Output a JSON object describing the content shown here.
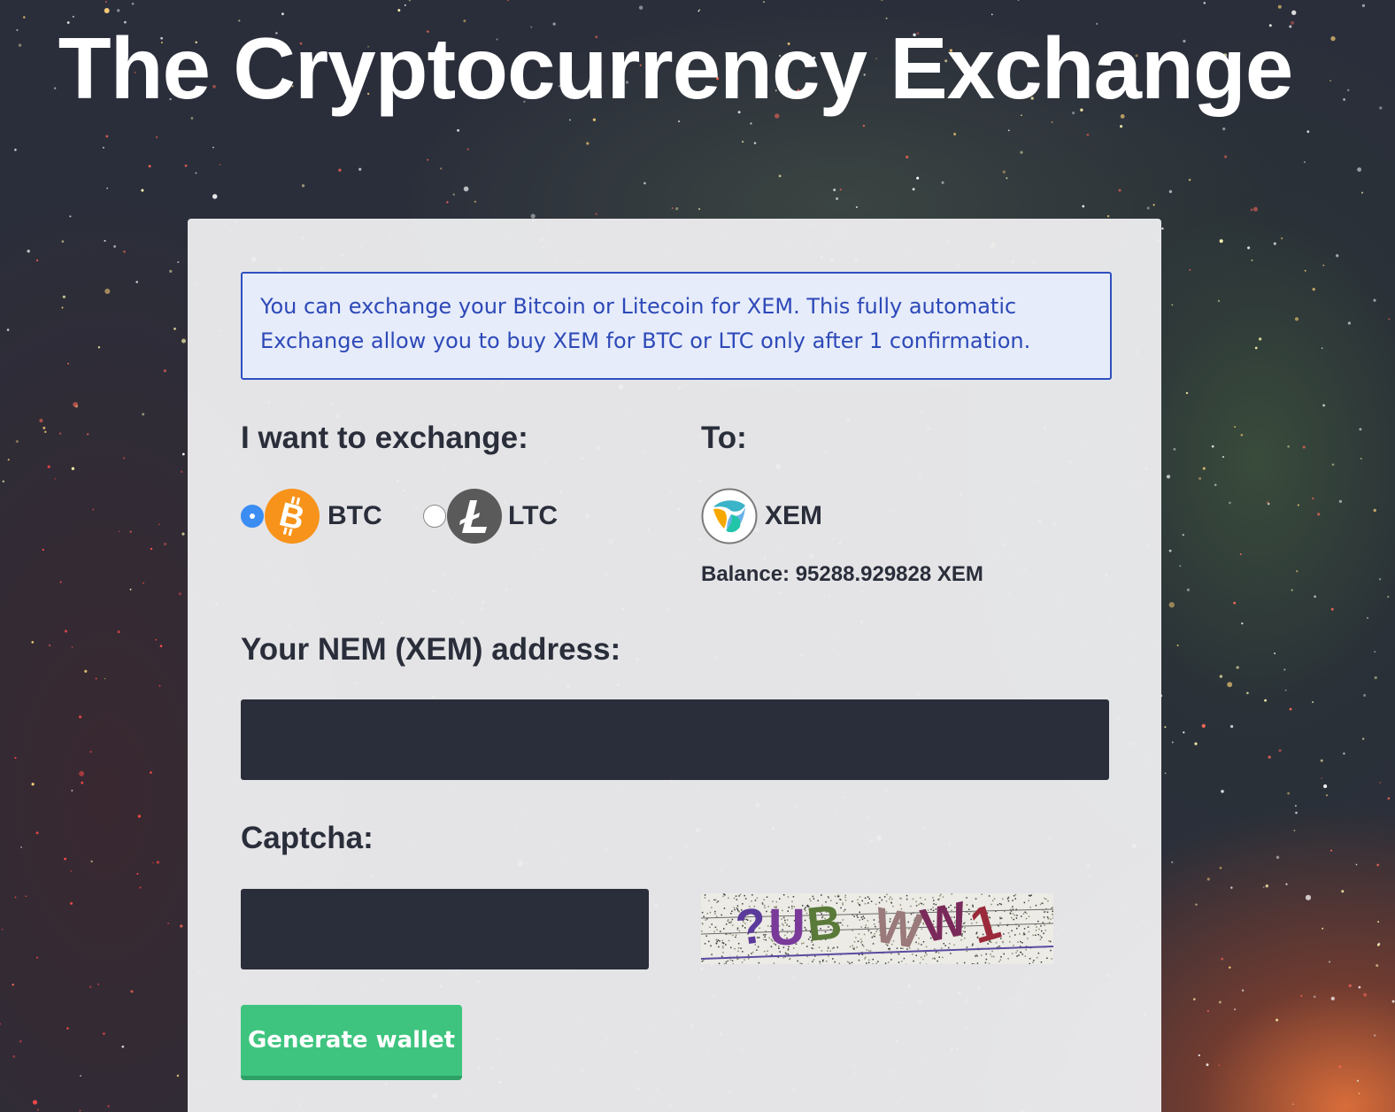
{
  "header": {
    "title": "The Cryptocurrency Exchange"
  },
  "info": {
    "message": "You can exchange your Bitcoin or Litecoin for XEM. This fully automatic Exchange allow you to buy XEM for BTC or LTC only after 1 confirmation."
  },
  "exchange": {
    "from_label": "I want to exchange:",
    "to_label": "To:",
    "options": [
      {
        "code": "BTC",
        "icon": "bitcoin-icon",
        "selected": true,
        "color": "#f7931a"
      },
      {
        "code": "LTC",
        "icon": "litecoin-icon",
        "selected": false,
        "color": "#5a5a5a"
      }
    ],
    "target": {
      "code": "XEM",
      "icon": "nem-icon"
    },
    "balance": "Balance: 95288.929828 XEM"
  },
  "form": {
    "address_label": "Your NEM (XEM) address:",
    "address_value": "",
    "captcha_label": "Captcha:",
    "captcha_value": "",
    "captcha_image_text": "?UB WW1",
    "submit_label": "Generate wallet"
  },
  "colors": {
    "accent_green": "#3ec47f",
    "info_blue": "#2d49b8",
    "dark_input": "#2a2e3a",
    "radio_blue": "#3b8df2"
  }
}
